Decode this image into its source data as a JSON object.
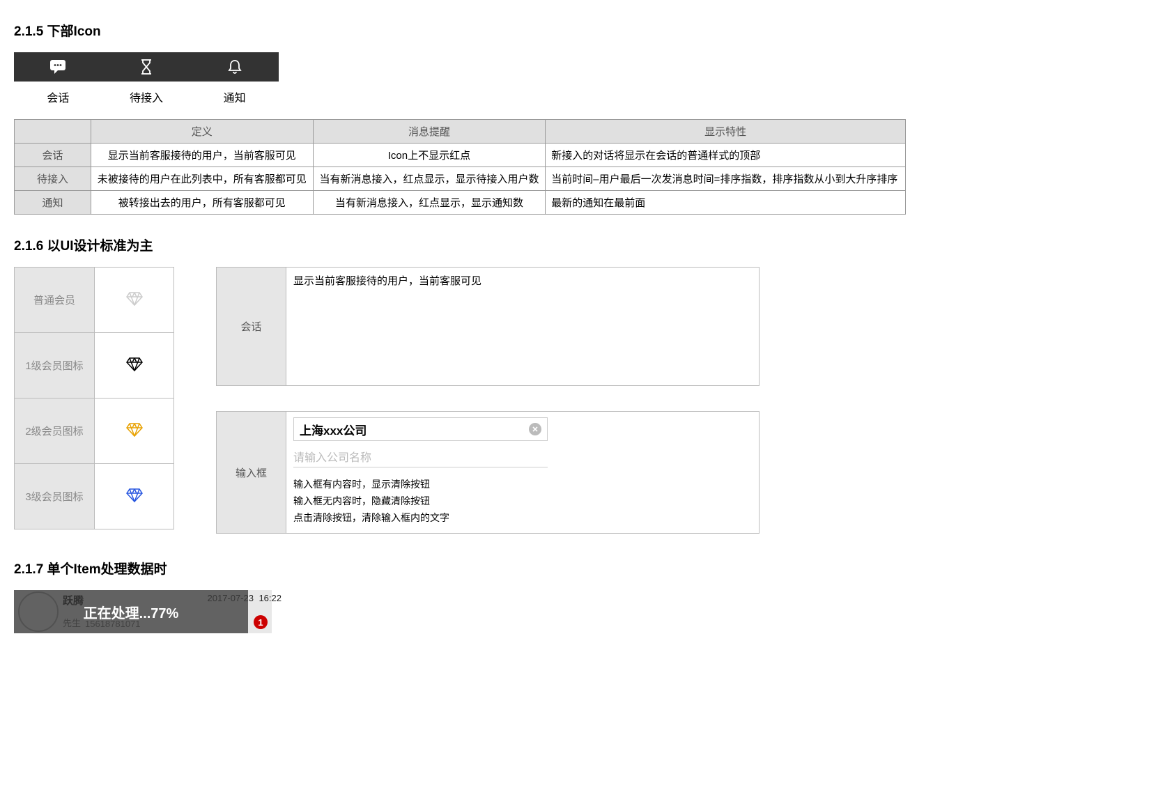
{
  "sections": {
    "s215": {
      "title": "2.1.5 下部Icon"
    },
    "s216": {
      "title": "2.1.6 以UI设计标准为主"
    },
    "s217": {
      "title": "2.1.7 单个Item处理数据时"
    }
  },
  "tabbar": {
    "items": [
      {
        "icon": "chat-icon",
        "label": "会话"
      },
      {
        "icon": "hourglass-icon",
        "label": "待接入"
      },
      {
        "icon": "bell-icon",
        "label": "通知"
      }
    ]
  },
  "icon_table": {
    "headers": [
      "",
      "定义",
      "消息提醒",
      "显示特性"
    ],
    "rows": [
      {
        "name": "会话",
        "def": "显示当前客服接待的用户，当前客服可见",
        "notify": "Icon上不显示红点",
        "display": "新接入的对话将显示在会话的普通样式的顶部"
      },
      {
        "name": "待接入",
        "def": "未被接待的用户在此列表中，所有客服都可见",
        "notify": "当有新消息接入，红点显示，显示待接入用户数",
        "display": "当前时间–用户最后一次发消息时间=排序指数，排序指数从小到大升序排序"
      },
      {
        "name": "通知",
        "def": "被转接出去的用户，所有客服都可见",
        "notify": "当有新消息接入，红点显示，显示通知数",
        "display": "最新的通知在最前面"
      }
    ]
  },
  "member_levels": [
    {
      "label": "普通会员",
      "color_class": "diamond-gray"
    },
    {
      "label": "1级会员图标",
      "color_class": "diamond-black"
    },
    {
      "label": "2级会员图标",
      "color_class": "diamond-gold"
    },
    {
      "label": "3级会员图标",
      "color_class": "diamond-blue"
    }
  ],
  "spec_boxes": {
    "session": {
      "label": "会话",
      "desc": "显示当前客服接待的用户，当前客服可见"
    },
    "input": {
      "label": "输入框",
      "filled_value": "上海xxx公司",
      "placeholder": "请输入公司名称",
      "notes": [
        "输入框有内容时，显示清除按钮",
        "输入框无内容时，隐藏清除按钮",
        "点击清除按钮，清除输入框内的文字"
      ]
    }
  },
  "item": {
    "name": "跃腾",
    "date": "2017-07-23",
    "time": "16:22",
    "title_prefix": "先生",
    "phone": "15618781071",
    "overlay_text": "正在处理...77%",
    "badge": "1"
  }
}
